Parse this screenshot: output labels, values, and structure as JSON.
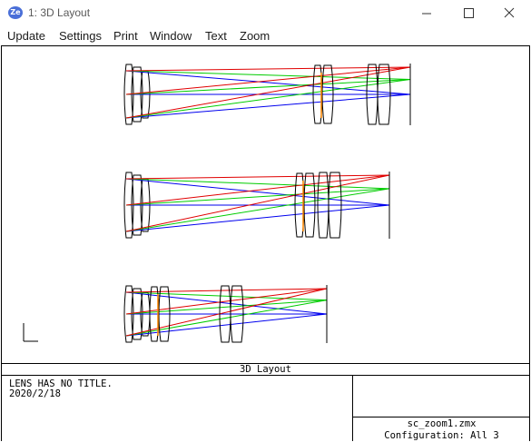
{
  "window": {
    "title": "1: 3D Layout",
    "app_icon_text": "Ze"
  },
  "menu": {
    "items": [
      "Update",
      "Settings",
      "Print",
      "Window",
      "Text",
      "Zoom"
    ]
  },
  "plot": {
    "caption": "3D Layout",
    "colors": {
      "field1": "#0000ee",
      "field2": "#00cc00",
      "field3": "#e00000",
      "lens": "#000000",
      "stop": "#ff8800"
    }
  },
  "info": {
    "title_line": "LENS HAS NO TITLE.",
    "date": "2020/2/18",
    "file": "sc_zoom1.zmx",
    "configuration": "Configuration: All 3"
  }
}
